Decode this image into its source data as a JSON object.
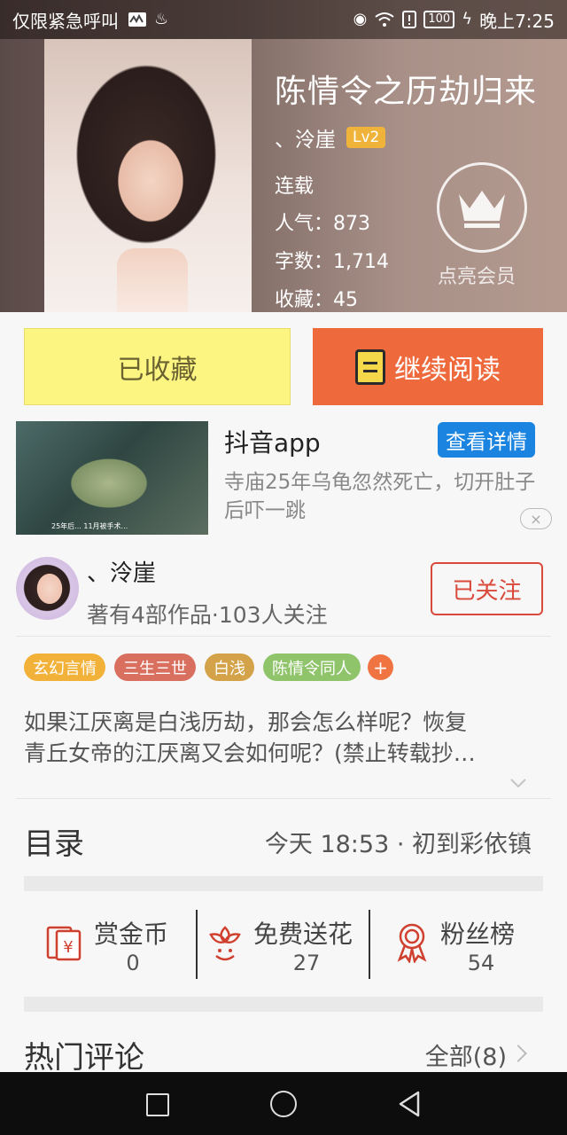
{
  "status_bar": {
    "carrier": "仅限紧急呼叫",
    "battery": "100",
    "time": "晚上7:25"
  },
  "book": {
    "title": "陈情令之历劫归来",
    "author": "、泠崖",
    "author_level": "Lv2",
    "status": "连载",
    "popularity": "人气：873",
    "word_count": "字数：1,714",
    "favorites": "收藏：45",
    "vip_label": "点亮会员"
  },
  "actions": {
    "collected_label": "已收藏",
    "continue_label": "继续阅读"
  },
  "ad": {
    "title": "抖音app",
    "detail_label": "查看详情",
    "description": "寺庙25年乌龟忽然死亡，切开肚子后吓一跳",
    "close_label": "×",
    "thumb_caption": "25年后... 11月被手术..."
  },
  "author_card": {
    "name": "、泠崖",
    "stats": "著有4部作品·103人关注",
    "follow_label": "已关注"
  },
  "tags": [
    {
      "label": "玄幻言情",
      "color": "#f2b23a"
    },
    {
      "label": "三生三世",
      "color": "#d9705f"
    },
    {
      "label": "白浅",
      "color": "#d4a248"
    },
    {
      "label": "陈情令同人",
      "color": "#8fc46b"
    }
  ],
  "tag_add_label": "+",
  "synopsis": {
    "line1": "如果江厌离是白浅历劫，那会怎么样呢？恢复",
    "line2": "青丘女帝的江厌离又会如何呢？(禁止转载抄…"
  },
  "catalog": {
    "title": "目录",
    "latest": "今天 18:53 · 初到彩依镇"
  },
  "stats": [
    {
      "label": "赏金币",
      "value": "0",
      "icon": "red-envelope-icon"
    },
    {
      "label": "免费送花",
      "value": "27",
      "icon": "flower-icon"
    },
    {
      "label": "粉丝榜",
      "value": "54",
      "icon": "medal-icon"
    }
  ],
  "comments": {
    "title": "热门评论",
    "all_label": "全部(8)"
  },
  "colors": {
    "accent_orange": "#ee6a3c",
    "collected_yellow": "#fdf582",
    "follow_red": "#d94a3b",
    "ad_blue": "#1a84e0"
  }
}
